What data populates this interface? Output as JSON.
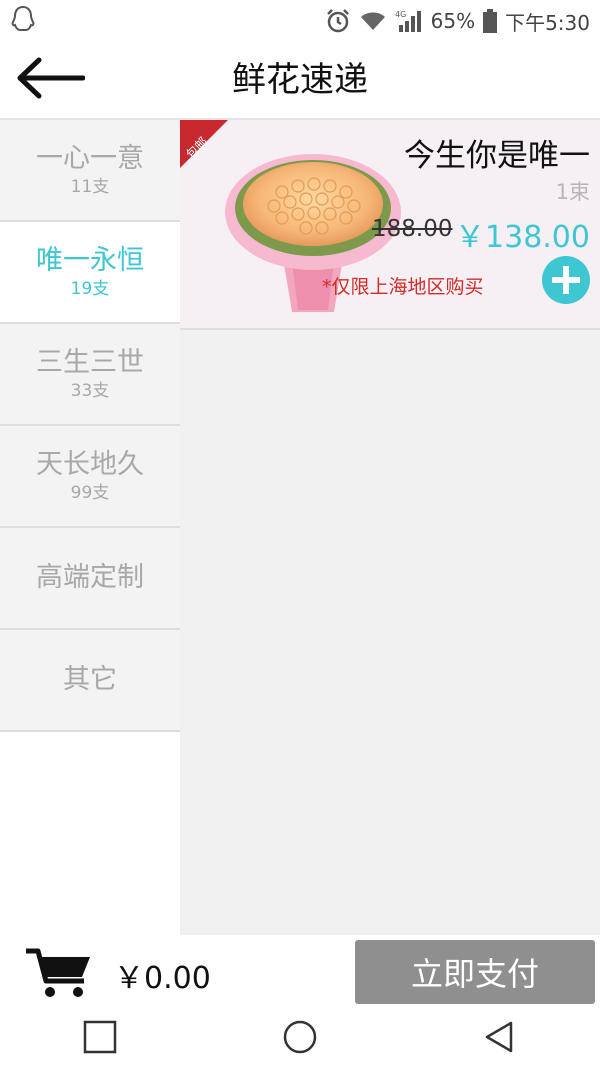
{
  "status_bar": {
    "battery": "65%",
    "time": "下午5:30",
    "network": "4G",
    "icons": [
      "qq-icon",
      "alarm-icon",
      "wifi-icon",
      "signal-icon",
      "battery-icon"
    ]
  },
  "header": {
    "title": "鲜花速递",
    "back_icon": "arrow-left-icon"
  },
  "sidebar": {
    "active_index": 1,
    "items": [
      {
        "name": "一心一意",
        "count": "11支"
      },
      {
        "name": "唯一永恒",
        "count": "19支"
      },
      {
        "name": "三生三世",
        "count": "33支"
      },
      {
        "name": "天长地久",
        "count": "99支"
      },
      {
        "name": "高端定制",
        "count": ""
      },
      {
        "name": "其它",
        "count": ""
      }
    ]
  },
  "product": {
    "badge": "包邮",
    "name": "今生你是唯一",
    "unit": "1束",
    "original_price": "188.00",
    "price": "￥138.00",
    "note": "*仅限上海地区购买",
    "add_icon": "plus-circle-icon"
  },
  "bottom": {
    "cart_icon": "cart-icon",
    "total": "￥0.00",
    "pay_label": "立即支付"
  },
  "colors": {
    "accent": "#3ec6d3",
    "warning": "#d32a2a",
    "badge": "#c9282e",
    "pay_button": "#8f8f8f"
  }
}
